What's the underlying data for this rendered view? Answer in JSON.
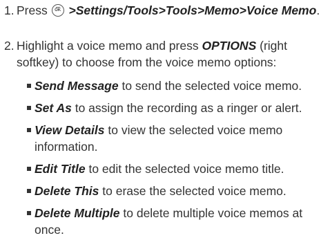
{
  "steps": [
    {
      "number": "1.",
      "prefix": "Press",
      "icon": "ok-key-icon",
      "path": ">Settings/Tools>Tools>Memo>Voice Memo",
      "suffix": "."
    },
    {
      "number": "2.",
      "text_before": "Highlight a voice memo and press",
      "options_label": "OPTIONS",
      "text_after": "(right softkey) to choose from the voice memo options:"
    }
  ],
  "options": [
    {
      "label": "Send Message",
      "description": "to send the selected voice memo."
    },
    {
      "label": "Set As",
      "description": "to assign the recording as a ringer or alert."
    },
    {
      "label": "View Details",
      "description": "to view the selected voice memo information."
    },
    {
      "label": "Edit Title",
      "description": "to edit the selected voice memo title."
    },
    {
      "label": "Delete This",
      "description": "to erase the selected voice memo."
    },
    {
      "label": "Delete Multiple",
      "description": "to delete multiple voice memos at once."
    }
  ]
}
